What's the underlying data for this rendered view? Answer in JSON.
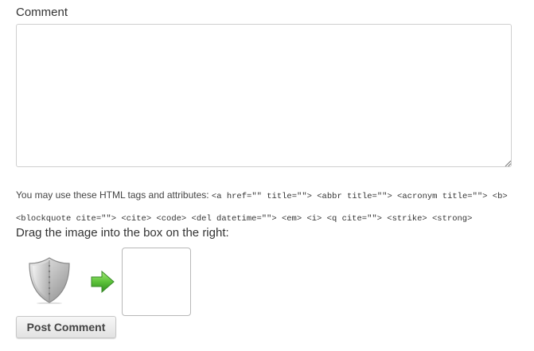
{
  "comment": {
    "label": "Comment",
    "value": ""
  },
  "allowed_tags": {
    "intro": "You may use these HTML tags and attributes:",
    "line1": "<a href=\"\" title=\"\"> <abbr title=\"\"> <acronym title=\"\"> <b>",
    "line2": "<blockquote cite=\"\"> <cite> <code> <del datetime=\"\"> <em> <i> <q cite=\"\"> <strike> <strong>"
  },
  "captcha": {
    "instruction": "Drag the image into the box on the right:",
    "draggable_icon": "shield-icon",
    "arrow_icon": "arrow-right-icon"
  },
  "submit": {
    "label": "Post Comment"
  },
  "colors": {
    "arrow_green": "#5cc23a",
    "shield_silver": "#b9b9b9",
    "button_text": "#444444"
  }
}
